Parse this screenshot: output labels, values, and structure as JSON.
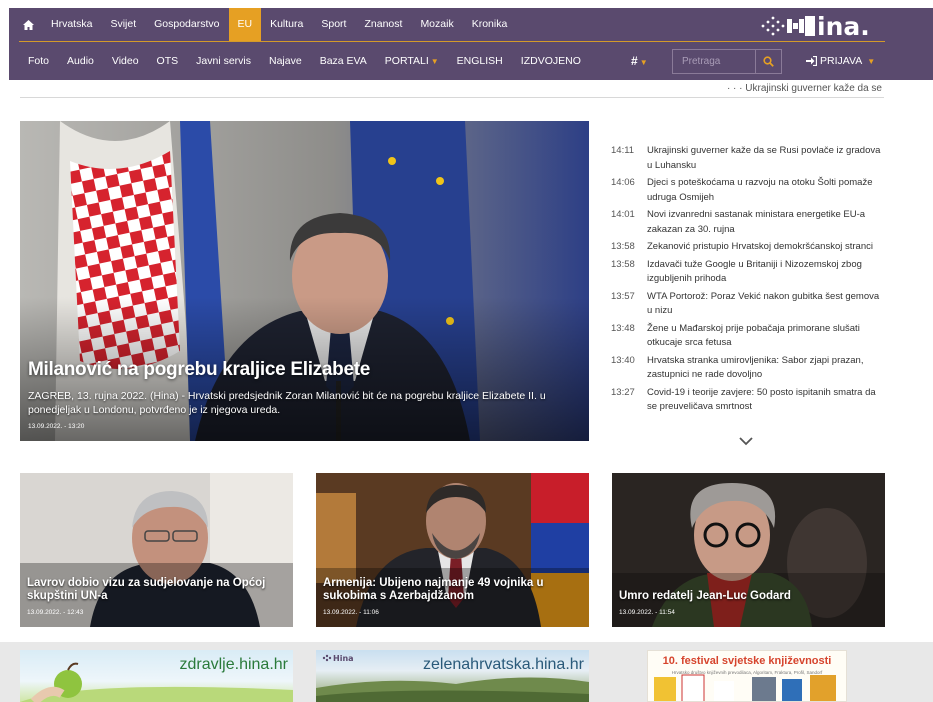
{
  "nav_top": {
    "items": [
      "Hrvatska",
      "Svijet",
      "Gospodarstvo",
      "EU",
      "Kultura",
      "Sport",
      "Znanost",
      "Mozaik",
      "Kronika"
    ],
    "active": "EU"
  },
  "nav_bottom": {
    "items": [
      "Foto",
      "Audio",
      "Video",
      "OTS",
      "Javni servis",
      "Najave",
      "Baza EVA",
      "PORTALI",
      "ENGLISH",
      "IZDVOJENO"
    ]
  },
  "search": {
    "placeholder": "Pretraga"
  },
  "login": {
    "label": "PRIJAVA"
  },
  "ticker": {
    "text": "· · · Ukrajinski guverner kaže da se"
  },
  "hero": {
    "title": "Milanović na pogrebu kraljice Elizabete",
    "lead": "ZAGREB, 13. rujna 2022. (Hina) - Hrvatski predsjednik Zoran Milanović bit će na pogrebu kraljice Elizabete II. u ponedjeljak u Londonu, potvrđeno je iz njegova ureda.",
    "date": "13.09.2022. - 13:20"
  },
  "news": [
    {
      "time": "14:11",
      "text": "Ukrajinski guverner kaže da se Rusi povlače iz gradova u Luhansku"
    },
    {
      "time": "14:06",
      "text": "Djeci s poteškoćama u razvoju na otoku Šolti pomaže udruga Osmijeh"
    },
    {
      "time": "14:01",
      "text": "Novi izvanredni sastanak ministara energetike EU-a zakazan za 30. rujna"
    },
    {
      "time": "13:58",
      "text": "Zekanović pristupio Hrvatskoj demokršćanskoj stranci"
    },
    {
      "time": "13:58",
      "text": "Izdavači tuže Google u Britaniji i Nizozemskoj zbog izgubljenih prihoda"
    },
    {
      "time": "13:57",
      "text": "WTA Portorož: Poraz Vekić nakon gubitka šest gemova u nizu"
    },
    {
      "time": "13:48",
      "text": "Žene u Mađarskoj prije pobačaja primorane slušati otkucaje srca fetusa"
    },
    {
      "time": "13:40",
      "text": "Hrvatska stranka umirovljenika: Sabor zjapi prazan, zastupnici ne rade dovoljno"
    },
    {
      "time": "13:27",
      "text": "Covid-19 i teorije zavjere: 50 posto ispitanih smatra da se preuveličava smrtnost"
    }
  ],
  "cards": [
    {
      "title": "Lavrov dobio vizu za sudjelovanje na Općoj skupštini UN-a",
      "date": "13.09.2022. - 12:43"
    },
    {
      "title": "Armenija: Ubijeno najmanje 49 vojnika u sukobima s Azerbajdžanom",
      "date": "13.09.2022. - 11:06"
    },
    {
      "title": "Umro redatelj Jean-Luc Godard",
      "date": "13.09.2022. - 11:54"
    }
  ],
  "portals": [
    {
      "label": "zdravlje.hina.hr"
    },
    {
      "label": "zelenahrvatska.hina.hr"
    },
    {
      "label": "10. festival svjetske književnosti",
      "sub": "Hrvatsko društvo književnih prevodilaca, Algoritam, Fraktura, Profil, Sandorf"
    }
  ],
  "colors": {
    "header_bg": "#5a4a6e",
    "accent": "#e6a023"
  },
  "icons": [
    "home-icon",
    "hash-icon",
    "search-icon",
    "login-icon",
    "chevron-down-icon",
    "hina-logo"
  ]
}
